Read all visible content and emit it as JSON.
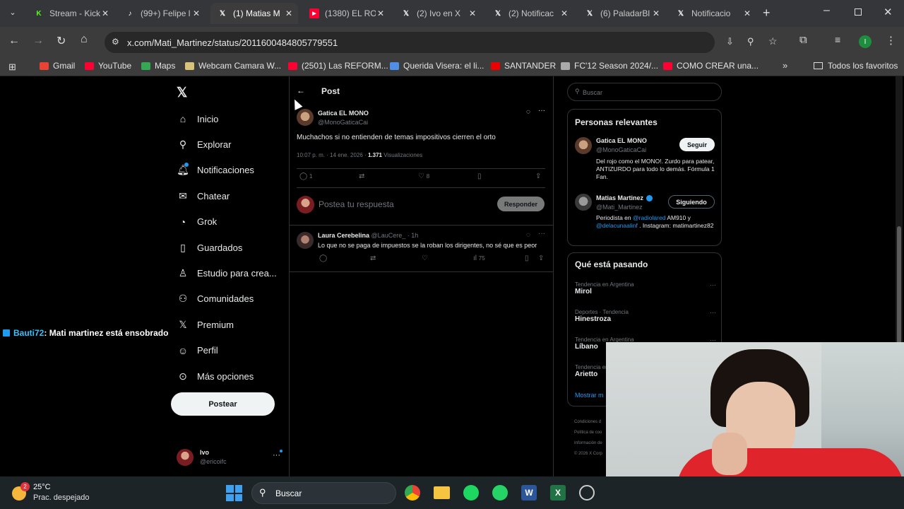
{
  "browser": {
    "tabs": [
      {
        "label": "Stream - Kick",
        "icon": "kick-icon",
        "color": "#53fc18"
      },
      {
        "label": "(99+) Felipe l",
        "icon": "tiktok-icon",
        "color": "#ffffff"
      },
      {
        "label": "(1) Matias M",
        "icon": "x-icon",
        "color": "#ffffff",
        "active": true
      },
      {
        "label": "(1380) EL RO",
        "icon": "youtube-icon",
        "color": "#ff0033"
      },
      {
        "label": "(2) Ivo en X",
        "icon": "x-icon",
        "color": "#ffffff"
      },
      {
        "label": "(2) Notificac",
        "icon": "x-icon",
        "color": "#ffffff"
      },
      {
        "label": "(6) PaladarBl",
        "icon": "x-icon",
        "color": "#ffffff"
      },
      {
        "label": "Notificacio",
        "icon": "x-icon",
        "color": "#ffffff"
      }
    ],
    "url": "x.com/Mati_Martinez/status/2011600484805779551",
    "profile_initial": "I",
    "bookmarks": [
      {
        "label": "Gmail",
        "color": "#ea4335"
      },
      {
        "label": "YouTube",
        "color": "#ff0033"
      },
      {
        "label": "Maps",
        "color": "#34a853"
      },
      {
        "label": "Webcam Camara W...",
        "color": "#d9c27a"
      },
      {
        "label": "(2501) Las REFORM...",
        "color": "#ff0033"
      },
      {
        "label": "Querida Visera: el li...",
        "color": "#4f8fe8"
      },
      {
        "label": "SANTANDER",
        "color": "#ec0000"
      },
      {
        "label": "FC'12 Season 2024/...",
        "color": "#aaaaaa"
      },
      {
        "label": "COMO CREAR una...",
        "color": "#ff0033"
      }
    ],
    "all_bookmarks": "Todos los favoritos"
  },
  "sidebar": {
    "items": [
      {
        "label": "Inicio",
        "icon": "home-icon"
      },
      {
        "label": "Explorar",
        "icon": "search-icon"
      },
      {
        "label": "Notificaciones",
        "icon": "bell-icon"
      },
      {
        "label": "Chatear",
        "icon": "mail-icon"
      },
      {
        "label": "Grok",
        "icon": "grok-icon"
      },
      {
        "label": "Guardados",
        "icon": "bookmark-icon"
      },
      {
        "label": "Estudio para crea...",
        "icon": "studio-icon"
      },
      {
        "label": "Comunidades",
        "icon": "communities-icon"
      },
      {
        "label": "Premium",
        "icon": "x-icon"
      },
      {
        "label": "Perfil",
        "icon": "person-icon"
      },
      {
        "label": "Más opciones",
        "icon": "more-icon"
      }
    ],
    "post_button": "Postear",
    "account_name": "Ivo",
    "account_handle": "@ericoifc"
  },
  "overlay_chat": {
    "user": "Bauti72",
    "message": ": Mati martinez está ensobrado"
  },
  "main": {
    "header": "Post",
    "post": {
      "author": "Gatica EL MONO",
      "handle": "@MonoGaticaCai",
      "text": "Muchachos si no entienden de temas impositivos cierren el orto",
      "time": "10:07 p. m. · 14 ene. 2026 ·",
      "views_count": "1.371",
      "views_label": "Visualizaciones",
      "replies": "1",
      "likes": "8"
    },
    "reply_placeholder": "Postea tu respuesta",
    "reply_button": "Responder",
    "reply": {
      "author": "Laura Cerebelina",
      "handle": "@LauCere_ · 1h",
      "text": "Lo que no se paga de impuestos se la roban los dirigentes, no sé que es peor",
      "views": "75"
    }
  },
  "right": {
    "search_placeholder": "Buscar",
    "relevant_title": "Personas relevantes",
    "people": [
      {
        "name": "Gatica EL MONO",
        "handle": "@MonoGaticaCai",
        "button": "Seguir",
        "bio": "Del rojo como el MONO!. Zurdo para patear, ANTIZURDO para todo lo demás. Fórmula 1 Fan."
      },
      {
        "name": "Matias Martinez",
        "handle": "@Mati_Martinez",
        "button": "Siguiendo",
        "bio_a": "Periodista en ",
        "link1": "@radiolared",
        "bio_b": " AM910 y ",
        "link2": "@delacunaalinf",
        "bio_c": " . Instagram: matimartinez82"
      }
    ],
    "trends_title": "Qué está pasando",
    "trends": [
      {
        "category": "Tendencia en Argentina",
        "name": "Mirol"
      },
      {
        "category": "Deportes · Tendencia",
        "name": "Hinestroza"
      },
      {
        "category": "Tendencia en Argentina",
        "name": "Líbano"
      },
      {
        "category": "Tendencia en",
        "name": "Arietto"
      }
    ],
    "show_more": "Mostrar m",
    "footer": [
      "Condiciones d",
      "Política de coo",
      "Información de",
      "© 2026 X Corp"
    ]
  },
  "taskbar": {
    "temp": "25°C",
    "weather": "Prac. despejado",
    "weather_badge": "2",
    "search": "Buscar"
  }
}
